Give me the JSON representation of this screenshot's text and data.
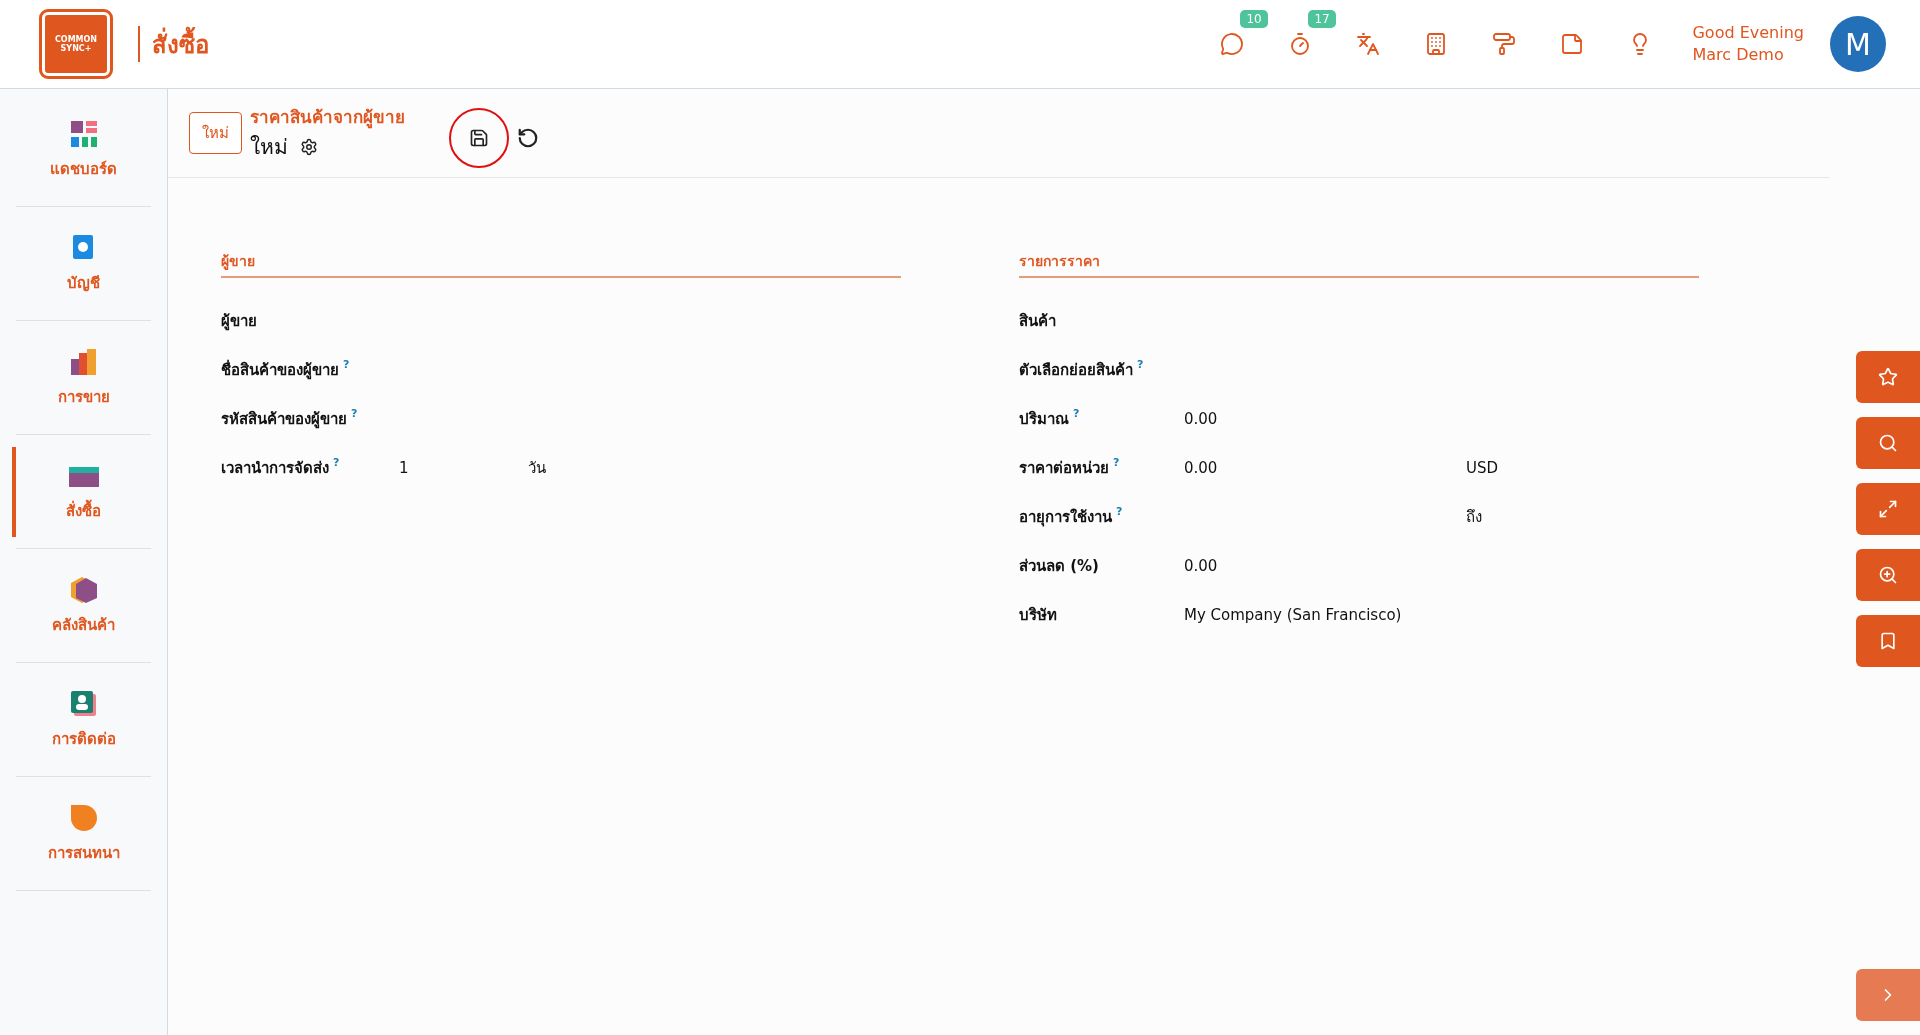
{
  "header": {
    "logo_text": [
      "COMMON",
      "SYNC+"
    ],
    "app_title": "สั่งซื้อ",
    "badges": [
      {
        "count": "10"
      },
      {
        "count": "17"
      }
    ],
    "greeting": "Good Evening",
    "user_name": "Marc Demo",
    "avatar_letter": "M"
  },
  "sidebar": {
    "items": [
      {
        "label": "แดชบอร์ด",
        "selected": false
      },
      {
        "label": "บัญชี",
        "selected": false
      },
      {
        "label": "การขาย",
        "selected": false
      },
      {
        "label": "สั่งซื้อ",
        "selected": true
      },
      {
        "label": "คลังสินค้า",
        "selected": false
      },
      {
        "label": "การติดต่อ",
        "selected": false
      },
      {
        "label": "การสนทนา",
        "selected": false
      }
    ]
  },
  "breadcrumb": {
    "new_button": "ใหม่",
    "parent": "ราคาสินค้าจากผู้ขาย",
    "current": "ใหม่"
  },
  "sections": [
    {
      "title": "ผู้ขาย",
      "fields": [
        {
          "label": "ผู้ขาย"
        },
        {
          "label": "ชื่อสินค้าของผู้ขาย",
          "help": "?"
        },
        {
          "label": "รหัสสินค้าของผู้ขาย",
          "help": "?"
        },
        {
          "label": "เวลานำการจัดส่ง",
          "help": "?",
          "value": "1",
          "suffix": "วัน"
        }
      ]
    },
    {
      "title": "รายการราคา",
      "fields": [
        {
          "label": "สินค้า"
        },
        {
          "label": "ตัวเลือกย่อยสินค้า",
          "help": "?"
        },
        {
          "label": "ปริมาณ",
          "help": "?",
          "value": "0.00"
        },
        {
          "label": "ราคาต่อหน่วย",
          "help": "?",
          "value": "0.00",
          "suffix": "USD"
        },
        {
          "label": "อายุการใช้งาน",
          "help": "?",
          "suffix": "ถึง"
        },
        {
          "label": "ส่วนลด (%)",
          "value": "0.00"
        },
        {
          "label": "บริษัท",
          "value": "My Company (San Francisco)"
        }
      ]
    }
  ]
}
